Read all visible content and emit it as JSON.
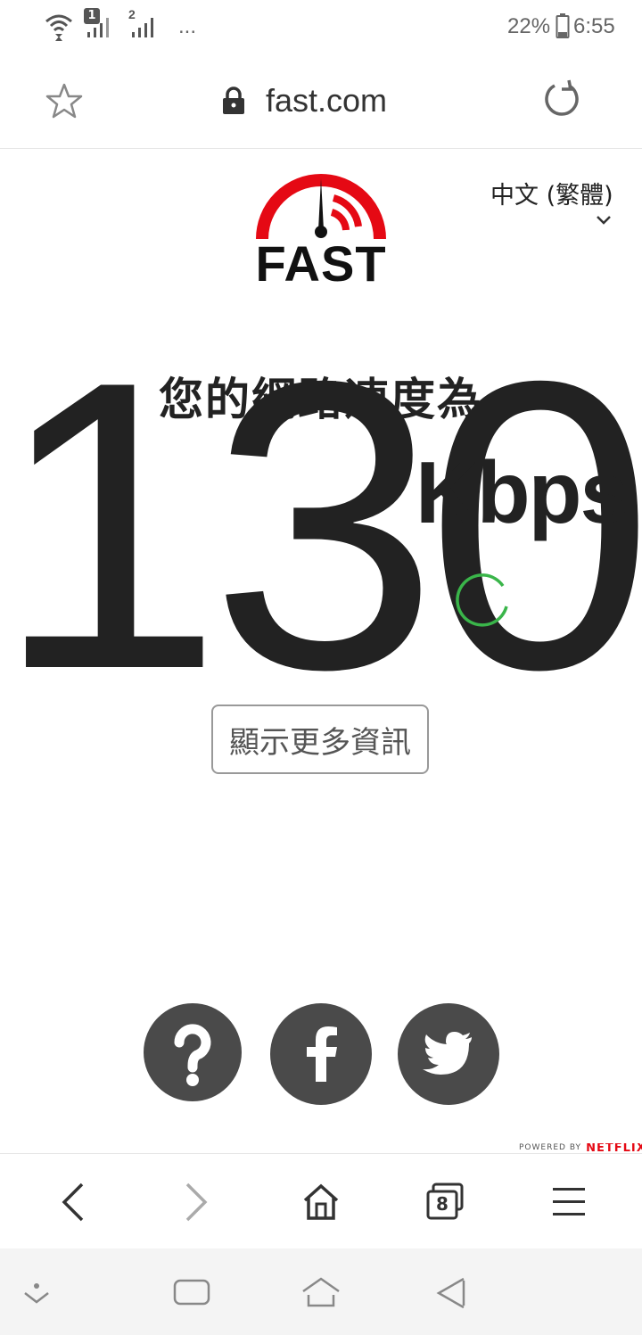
{
  "status_bar": {
    "sim1_badge": "1",
    "sim2_badge": "2",
    "more_indicator": "...",
    "battery_percent": "22%",
    "time": "6:55"
  },
  "browser": {
    "url": "fast.com",
    "icons": [
      "star-icon",
      "lock-icon",
      "reload-icon"
    ]
  },
  "page": {
    "logo_text": "FAST",
    "language": "中文 (繁體)",
    "heading": "您的網路速度為",
    "speed_value": "130",
    "speed_unit": "Kbps",
    "more_info_label": "顯示更多資訊",
    "powered_by_label": "POWERED BY",
    "powered_by_brand": "NETFLIX",
    "social": [
      "help-icon",
      "facebook-icon",
      "twitter-icon"
    ]
  },
  "toolbar": {
    "tab_count": "8",
    "icons": [
      "back-icon",
      "forward-icon",
      "home-icon",
      "tabs-icon",
      "menu-icon"
    ]
  },
  "colors": {
    "logo_red": "#e50914",
    "text_dark": "#222222",
    "social_circle": "#4a4a4a",
    "spinner_green": "#3ab54a"
  }
}
